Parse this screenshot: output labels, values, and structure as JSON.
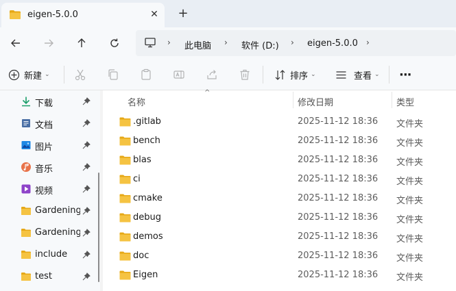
{
  "tab": {
    "title": "eigen-5.0.0",
    "close": "✕",
    "new": "+"
  },
  "breadcrumb": [
    "此电脑",
    "软件 (D:)",
    "eigen-5.0.0"
  ],
  "toolbar": {
    "new_label": "新建",
    "sort_label": "排序",
    "view_label": "查看",
    "more": "···"
  },
  "sidebar": {
    "items": [
      {
        "label": "下载",
        "icon": "download-icon"
      },
      {
        "label": "文档",
        "icon": "document-icon"
      },
      {
        "label": "图片",
        "icon": "picture-icon"
      },
      {
        "label": "音乐",
        "icon": "music-icon"
      },
      {
        "label": "视频",
        "icon": "video-icon"
      },
      {
        "label": "Gardening_!",
        "icon": "folder-icon"
      },
      {
        "label": "Gardening_(",
        "icon": "folder-icon"
      },
      {
        "label": "include",
        "icon": "folder-icon"
      },
      {
        "label": "test",
        "icon": "folder-icon"
      }
    ]
  },
  "columns": {
    "name": "名称",
    "date": "修改日期",
    "type": "类型"
  },
  "files": [
    {
      "name": ".gitlab",
      "date": "2025-11-12 18:36",
      "type": "文件夹"
    },
    {
      "name": "bench",
      "date": "2025-11-12 18:36",
      "type": "文件夹"
    },
    {
      "name": "blas",
      "date": "2025-11-12 18:36",
      "type": "文件夹"
    },
    {
      "name": "ci",
      "date": "2025-11-12 18:36",
      "type": "文件夹"
    },
    {
      "name": "cmake",
      "date": "2025-11-12 18:36",
      "type": "文件夹"
    },
    {
      "name": "debug",
      "date": "2025-11-12 18:36",
      "type": "文件夹"
    },
    {
      "name": "demos",
      "date": "2025-11-12 18:36",
      "type": "文件夹"
    },
    {
      "name": "doc",
      "date": "2025-11-12 18:36",
      "type": "文件夹"
    },
    {
      "name": "Eigen",
      "date": "2025-11-12 18:36",
      "type": "文件夹"
    }
  ],
  "colors": {
    "folder": "#f5c342",
    "folder_dark": "#e6a817",
    "accent": "#0067c0"
  }
}
